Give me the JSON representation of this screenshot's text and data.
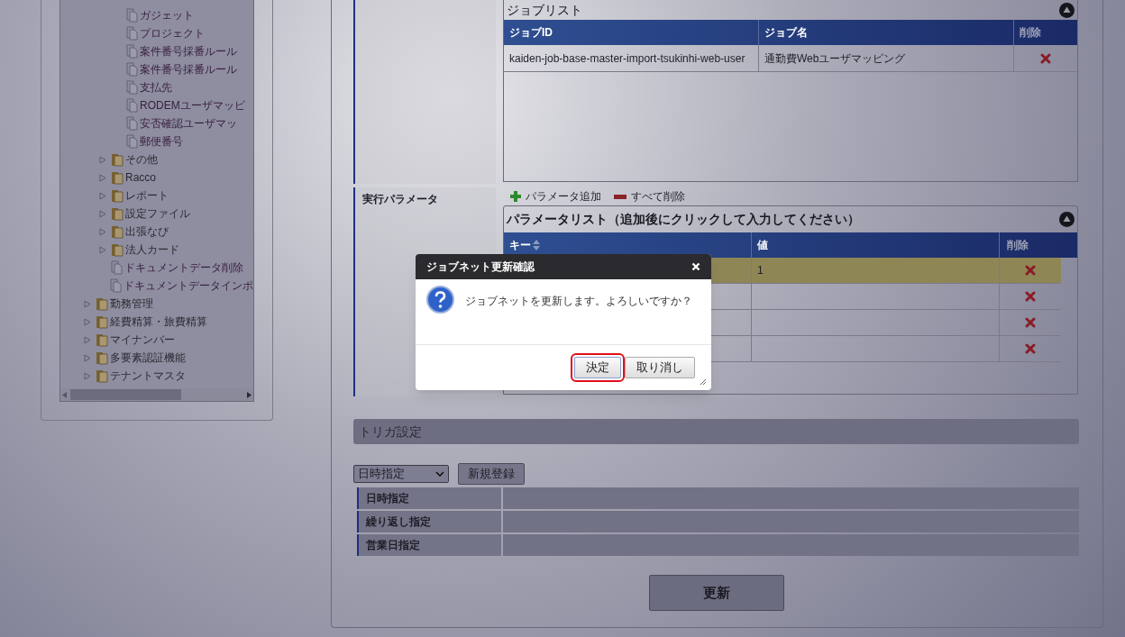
{
  "tree": {
    "items": [
      {
        "children": [
          {
            "children": [
              {
                "kind": "document",
                "label": "ガジェット"
              },
              {
                "kind": "document",
                "label": "プロジェクト"
              },
              {
                "kind": "document",
                "label": "案件番号採番ルール"
              },
              {
                "kind": "document",
                "label": "案件番号採番ルール"
              },
              {
                "kind": "document",
                "label": "支払先"
              },
              {
                "kind": "document",
                "label": "RODEMユーザマッピ"
              },
              {
                "kind": "document",
                "label": "安否確認ユーザマッ"
              },
              {
                "kind": "document",
                "label": "郵便番号"
              }
            ]
          },
          {
            "kind": "folder",
            "label": "その他",
            "expanded": false
          },
          {
            "kind": "folder",
            "label": "Racco",
            "expanded": false
          },
          {
            "kind": "folder",
            "label": "レポート",
            "expanded": false
          },
          {
            "kind": "folder",
            "label": "設定ファイル",
            "expanded": false
          },
          {
            "kind": "folder",
            "label": "出張なび",
            "expanded": false
          },
          {
            "kind": "folder",
            "label": "法人カード",
            "expanded": false
          },
          {
            "kind": "document",
            "label": "ドキュメントデータ削除"
          },
          {
            "kind": "document",
            "label": "ドキュメントデータインポ"
          }
        ]
      },
      {
        "kind": "folder",
        "label": "勤務管理",
        "expanded": false
      },
      {
        "kind": "folder",
        "label": "経費精算・旅費精算",
        "expanded": false
      },
      {
        "kind": "folder",
        "label": "マイナンバー",
        "expanded": false
      },
      {
        "kind": "folder",
        "label": "多要素認証機能",
        "expanded": false
      },
      {
        "kind": "folder",
        "label": "テナントマスタ",
        "expanded": false
      }
    ]
  },
  "job_list": {
    "title": "ジョブリスト",
    "columns": [
      "ジョブID",
      "ジョブ名",
      "削除"
    ],
    "rows": [
      {
        "job_id": "kaiden-job-base-master-import-tsukinhi-web-user",
        "job_name": "通勤費Webユーザマッピング"
      }
    ]
  },
  "params": {
    "label": "実行パラメータ",
    "actions": [
      {
        "kind": "add",
        "label": "パラメータ追加"
      },
      {
        "kind": "remove",
        "label": "すべて削除"
      }
    ],
    "list_title": "パラメータリスト（追加後にクリックして入力してください）",
    "columns": [
      "キー",
      "値",
      "削除"
    ],
    "rows": [
      {
        "value": "1",
        "selected": true
      },
      {
        "selected": false
      },
      {
        "selected": false
      },
      {
        "selected": false
      }
    ]
  },
  "trigger": {
    "title": "トリガ設定",
    "select": "日時指定",
    "new_button": "新規登録",
    "rows": [
      "日時指定",
      "繰り返し指定",
      "営業日指定"
    ]
  },
  "update_button": "更新",
  "dialog": {
    "title": "ジョブネット更新確認",
    "message": "ジョブネットを更新します。よろしいですか？",
    "buttons": [
      {
        "label": "決定",
        "focused": true
      },
      {
        "label": "取り消し",
        "focused": false
      }
    ]
  }
}
